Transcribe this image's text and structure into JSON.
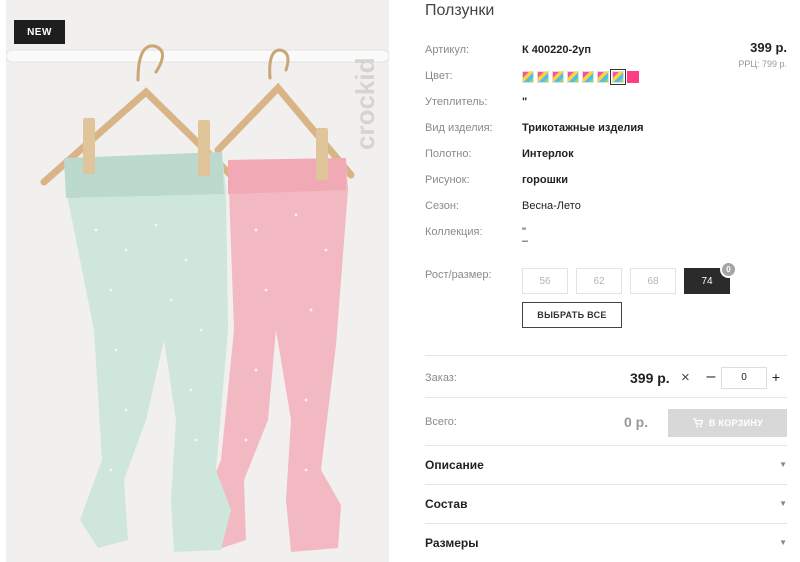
{
  "photo": {
    "badge": "NEW",
    "watermark": "crockid"
  },
  "product": {
    "title": "Ползунки",
    "price": "399 р.",
    "rrp": "РРЦ: 799 р.",
    "attributes": [
      {
        "label": "Артикул:",
        "value": "К 400220-2уп",
        "bold": true
      },
      {
        "label": "Цвет:",
        "value": ""
      },
      {
        "label": "Утеплитель:",
        "value": "\"",
        "bold": true
      },
      {
        "label": "Вид изделия:",
        "value": "Трикотажные изделия",
        "bold": true
      },
      {
        "label": "Полотно:",
        "value": "Интерлок",
        "bold": true
      },
      {
        "label": "Рисунок:",
        "value": "горошки",
        "bold": true
      },
      {
        "label": "Сезон:",
        "value": "Весна-Лето",
        "bold": false
      },
      {
        "label": "Коллекция:",
        "value": "\"\n–",
        "bold": false
      }
    ],
    "colors": {
      "swatch_count_multi": 7,
      "active_index": 6,
      "last": "#ff3d84"
    }
  },
  "sizes": {
    "label": "Рост/размер:",
    "options": [
      {
        "label": "56",
        "selected": false
      },
      {
        "label": "62",
        "selected": false
      },
      {
        "label": "68",
        "selected": false
      },
      {
        "label": "74",
        "selected": true,
        "count": "0"
      }
    ],
    "select_all": "ВЫБРАТЬ ВСЕ"
  },
  "order": {
    "label": "Заказ:",
    "price": "399 р.",
    "times": "×",
    "minus": "–",
    "qty": "0",
    "plus": "+"
  },
  "total": {
    "label": "Всего:",
    "value": "0 р.",
    "cart_button": "В КОРЗИНУ"
  },
  "accordion": [
    {
      "title": "Описание"
    },
    {
      "title": "Состав"
    },
    {
      "title": "Размеры"
    }
  ],
  "colors": {
    "pants_mint": "#cfe6dc",
    "pants_pink": "#f3b9c2",
    "hanger": "#d8b487"
  }
}
